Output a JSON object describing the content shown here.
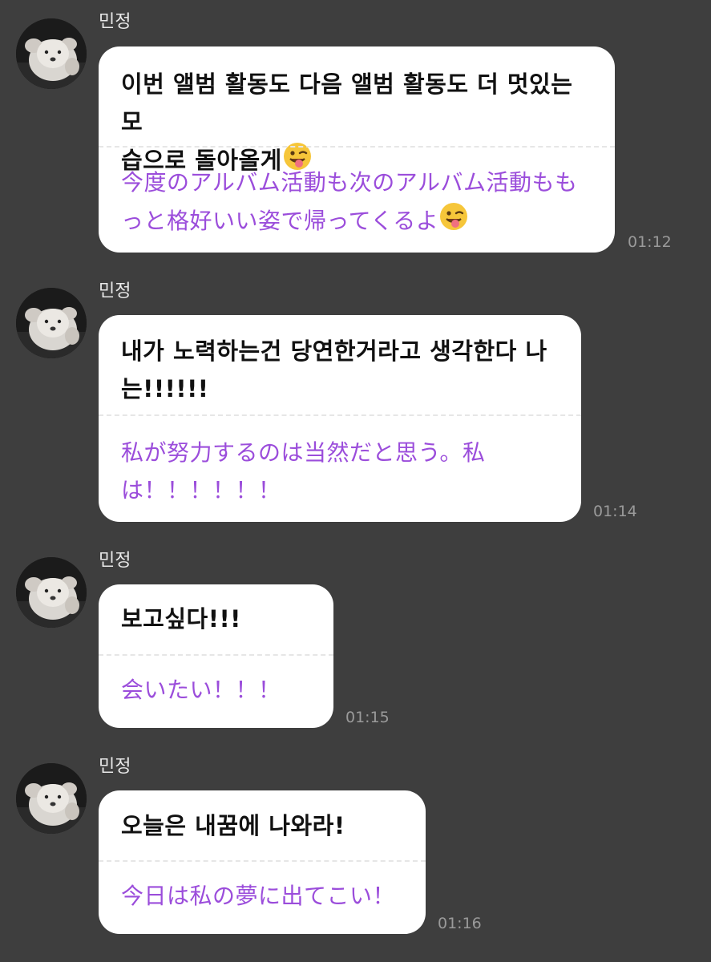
{
  "messages": [
    {
      "sender": "민정",
      "korean": "이번 앨범 활동도 다음 앨범 활동도 더 멋있는 모\n습으로 돌아올게",
      "japanese": "今度のアルバム活動も次のアルバム活動もも\nっと格好いい姿で帰ってくるよ",
      "emoji": "winking-tongue-face-emoji",
      "time": "01:12"
    },
    {
      "sender": "민정",
      "korean": "내가 노력하는건 당연한거라고 생각한다 나\n는!!!!!!",
      "japanese": "私が努力するのは当然だと思う。私\nは！！！！！！",
      "time": "01:14"
    },
    {
      "sender": "민정",
      "korean": "보고싶다!!!",
      "japanese": "会いたい！！！",
      "time": "01:15"
    },
    {
      "sender": "민정",
      "korean": "오늘은 내꿈에 나와라!",
      "japanese": "今日は私の夢に出てこい！",
      "time": "01:16"
    }
  ],
  "colors": {
    "background": "#3e3e3e",
    "bubble": "#ffffff",
    "korean_text": "#111111",
    "japanese_text": "#9b4ddb",
    "timestamp": "#9a9a9a",
    "sender_name": "#e9e9e9"
  }
}
